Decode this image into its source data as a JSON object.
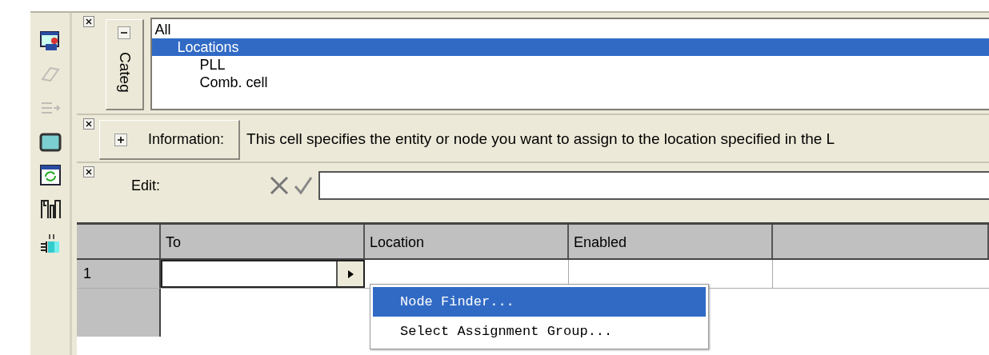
{
  "toolbar": {
    "items": [
      {
        "kind": "window"
      },
      {
        "kind": "eraser",
        "disabled": true
      },
      {
        "kind": "arrow",
        "disabled": true
      },
      {
        "kind": "screen"
      },
      {
        "kind": "refresh"
      },
      {
        "kind": "pins"
      },
      {
        "kind": "numbered"
      }
    ]
  },
  "category_panel": {
    "label": "Categ",
    "expanded": true,
    "tree": [
      {
        "label": "All",
        "selected": false,
        "children": [
          {
            "label": "Locations",
            "selected": true,
            "children": [
              {
                "label": "PLL",
                "selected": false
              },
              {
                "label": "Comb. cell",
                "selected": false
              }
            ]
          }
        ]
      }
    ]
  },
  "information_panel": {
    "label": "Information:",
    "expanded": false,
    "text": "This cell specifies the entity or node you want to assign to the location specified in the L"
  },
  "edit_panel": {
    "label": "Edit:"
  },
  "grid": {
    "columns": [
      "To",
      "Location",
      "Enabled"
    ],
    "rows": [
      {
        "number": "1",
        "to": "",
        "location": "",
        "enabled": ""
      }
    ]
  },
  "context_menu": {
    "items": [
      {
        "label": "Node Finder...",
        "selected": true
      },
      {
        "label": "Select Assignment Group...",
        "selected": false
      }
    ]
  }
}
